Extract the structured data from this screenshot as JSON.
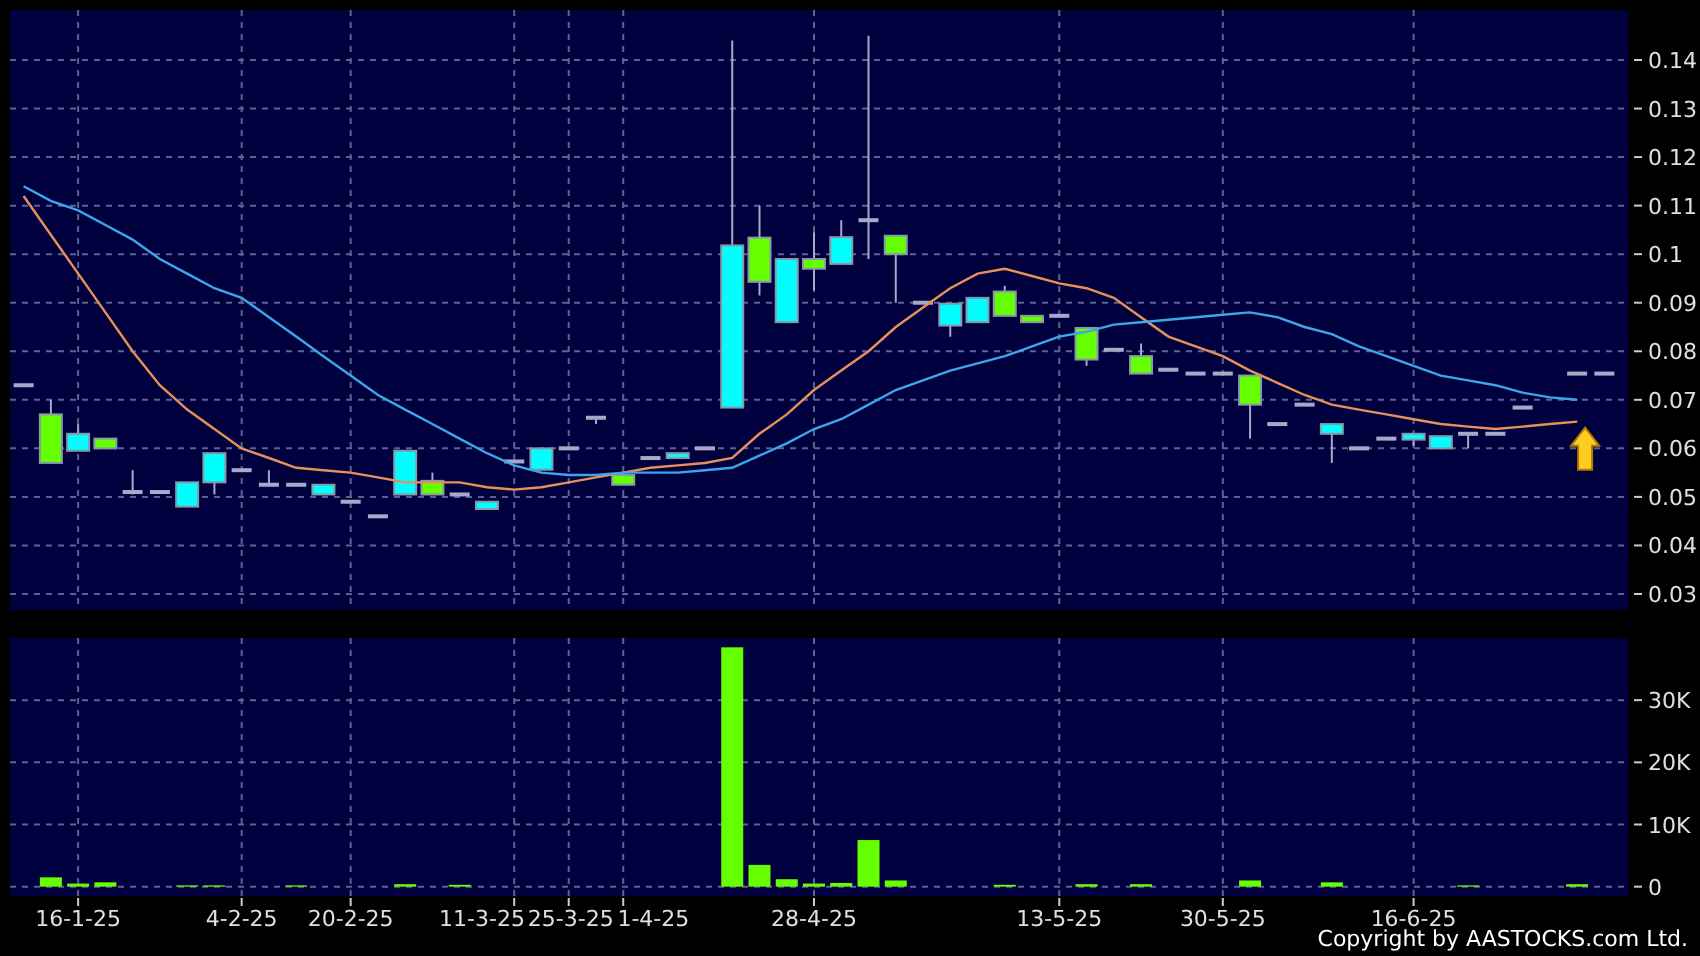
{
  "price_chart": {
    "chart_data": {
      "type": "candlestick",
      "grid": true,
      "ylim": [
        0.0267,
        0.1503
      ],
      "categories": [
        null,
        null,
        null,
        null,
        null,
        null,
        null,
        null,
        null,
        null,
        null,
        null,
        null,
        null,
        null,
        null,
        null,
        null,
        null,
        null,
        null,
        null,
        null,
        null,
        null,
        null,
        null,
        null,
        null,
        null,
        null,
        null,
        null,
        null,
        null,
        null,
        null,
        null,
        null,
        null,
        null,
        null,
        null,
        null,
        null,
        null,
        null,
        null,
        null,
        null,
        null,
        null,
        null,
        null,
        null,
        null,
        null,
        null,
        null
      ],
      "yticks": [
        {
          "value": 0.03,
          "label": "0.03"
        },
        {
          "value": 0.04,
          "label": "0.04"
        },
        {
          "value": 0.05,
          "label": "0.05"
        },
        {
          "value": 0.06,
          "label": "0.06"
        },
        {
          "value": 0.07,
          "label": "0.07"
        },
        {
          "value": 0.08,
          "label": "0.08"
        },
        {
          "value": 0.09,
          "label": "0.09"
        },
        {
          "value": 0.1,
          "label": "0.1"
        },
        {
          "value": 0.11,
          "label": "0.11"
        },
        {
          "value": 0.12,
          "label": "0.12"
        },
        {
          "value": 0.13,
          "label": "0.13"
        },
        {
          "value": 0.14,
          "label": "0.14"
        }
      ],
      "ohlc": [
        [
          0.073,
          0.073,
          0.073,
          0.073
        ],
        [
          0.067,
          0.07,
          0.057,
          0.057
        ],
        [
          0.0595,
          0.065,
          0.0595,
          0.063
        ],
        [
          0.062,
          0.062,
          0.06,
          0.06
        ],
        [
          0.051,
          0.0555,
          0.0505,
          0.051
        ],
        [
          0.051,
          0.051,
          0.051,
          0.051
        ],
        [
          0.048,
          0.053,
          0.048,
          0.053
        ],
        [
          0.053,
          0.059,
          0.0505,
          0.059
        ],
        [
          0.0555,
          0.0555,
          0.0555,
          0.0555
        ],
        [
          0.0525,
          0.0555,
          0.0525,
          0.0525
        ],
        [
          0.0525,
          0.0525,
          0.0525,
          0.0525
        ],
        [
          0.0505,
          0.0525,
          0.0505,
          0.0525
        ],
        [
          0.049,
          0.049,
          0.049,
          0.049
        ],
        [
          0.046,
          0.046,
          0.046,
          0.046
        ],
        [
          0.0505,
          0.0595,
          0.0505,
          0.0595
        ],
        [
          0.0533,
          0.055,
          0.0505,
          0.0505
        ],
        [
          0.0505,
          0.0505,
          0.0505,
          0.0505
        ],
        [
          0.0475,
          0.049,
          0.0475,
          0.049
        ],
        [
          0.0573,
          0.0573,
          0.0573,
          0.0573
        ],
        [
          0.0556,
          0.06,
          0.0556,
          0.06
        ],
        [
          0.06,
          0.06,
          0.06,
          0.06
        ],
        [
          0.0663,
          0.0663,
          0.065,
          0.0663
        ],
        [
          0.0545,
          0.0545,
          0.0525,
          0.0525
        ],
        [
          0.058,
          0.058,
          0.058,
          0.058
        ],
        [
          0.058,
          0.059,
          0.058,
          0.059
        ],
        [
          0.06,
          0.06,
          0.06,
          0.06
        ],
        [
          0.0684,
          0.144,
          0.0684,
          0.1018
        ],
        [
          0.1034,
          0.11,
          0.0915,
          0.0943
        ],
        [
          0.086,
          0.099,
          0.086,
          0.099
        ],
        [
          0.099,
          0.1045,
          0.0925,
          0.097
        ],
        [
          0.098,
          0.107,
          0.098,
          0.1035
        ],
        [
          0.107,
          0.145,
          0.099,
          0.107
        ],
        [
          0.1038,
          0.1038,
          0.09,
          0.1
        ],
        [
          0.09,
          0.09,
          0.09,
          0.09
        ],
        [
          0.0853,
          0.0898,
          0.083,
          0.0898
        ],
        [
          0.086,
          0.091,
          0.086,
          0.091
        ],
        [
          0.0923,
          0.0935,
          0.0873,
          0.0873
        ],
        [
          0.0873,
          0.0873,
          0.086,
          0.086
        ],
        [
          0.0873,
          0.0873,
          0.0873,
          0.0873
        ],
        [
          0.0848,
          0.0848,
          0.077,
          0.0783
        ],
        [
          0.0803,
          0.0803,
          0.0803,
          0.0803
        ],
        [
          0.079,
          0.0816,
          0.0754,
          0.0754
        ],
        [
          0.0762,
          0.0762,
          0.0762,
          0.0762
        ],
        [
          0.0754,
          0.0754,
          0.0754,
          0.0754
        ],
        [
          0.0754,
          0.0754,
          0.0754,
          0.0754
        ],
        [
          0.075,
          0.075,
          0.062,
          0.069
        ],
        [
          0.065,
          0.065,
          0.065,
          0.065
        ],
        [
          0.069,
          0.069,
          0.069,
          0.069
        ],
        [
          0.063,
          0.065,
          0.057,
          0.065
        ],
        [
          0.06,
          0.06,
          0.06,
          0.06
        ],
        [
          0.062,
          0.062,
          0.062,
          0.062
        ],
        [
          0.0618,
          0.063,
          0.0605,
          0.063
        ],
        [
          0.06,
          0.0625,
          0.06,
          0.0625
        ],
        [
          0.063,
          0.063,
          0.06,
          0.063
        ],
        [
          0.063,
          0.063,
          0.063,
          0.063
        ],
        [
          0.0684,
          0.0684,
          0.0684,
          0.0684
        ],
        null,
        [
          0.0754,
          0.0754,
          0.0754,
          0.0754
        ],
        [
          0.0754,
          0.0754,
          0.0754,
          0.0754
        ]
      ],
      "series": [
        {
          "type": "line",
          "color": "#e8905a",
          "values": [
            0.112,
            0.104,
            0.096,
            0.088,
            0.08,
            0.073,
            0.068,
            0.064,
            0.06,
            0.058,
            0.056,
            0.0555,
            0.055,
            0.054,
            0.053,
            0.053,
            0.053,
            0.052,
            0.0515,
            0.052,
            0.053,
            0.054,
            0.055,
            0.056,
            0.0565,
            0.057,
            0.058,
            0.063,
            0.067,
            0.072,
            0.076,
            0.08,
            0.085,
            0.089,
            0.093,
            0.096,
            0.097,
            0.0955,
            0.094,
            0.093,
            0.091,
            0.087,
            0.083,
            0.081,
            0.079,
            0.076,
            0.0735,
            0.071,
            0.069,
            0.068,
            0.067,
            0.066,
            0.065,
            0.0645,
            0.064,
            0.0645,
            0.065,
            0.0655,
            null
          ]
        },
        {
          "type": "line",
          "color": "#3aa8e8",
          "values": [
            0.114,
            0.111,
            0.109,
            0.106,
            0.103,
            0.099,
            0.096,
            0.093,
            0.091,
            0.087,
            0.083,
            0.079,
            0.075,
            0.071,
            0.068,
            0.065,
            0.062,
            0.059,
            0.0565,
            0.055,
            0.0545,
            0.0545,
            0.055,
            0.055,
            0.055,
            0.0555,
            0.056,
            0.0585,
            0.061,
            0.064,
            0.066,
            0.069,
            0.072,
            0.074,
            0.076,
            0.0775,
            0.079,
            0.081,
            0.083,
            0.084,
            0.0855,
            0.086,
            0.0865,
            0.087,
            0.0875,
            0.088,
            0.087,
            0.085,
            0.0835,
            0.081,
            0.079,
            0.077,
            0.075,
            0.074,
            0.073,
            0.0715,
            0.0705,
            0.07,
            null
          ]
        }
      ]
    }
  },
  "volume_chart": {
    "chart_data": {
      "type": "bar",
      "grid": true,
      "ylim": [
        -1.5,
        40
      ],
      "categories": [
        null,
        null,
        "16-1-25",
        null,
        null,
        null,
        null,
        null,
        "4-2-25",
        null,
        null,
        null,
        "20-2-25",
        null,
        null,
        null,
        null,
        null,
        "11-3-25",
        null,
        "25-3-25",
        null,
        "1-4-25",
        null,
        null,
        null,
        null,
        null,
        null,
        "28-4-25",
        null,
        null,
        null,
        null,
        null,
        null,
        null,
        null,
        "13-5-25",
        null,
        null,
        null,
        null,
        null,
        "30-5-25",
        null,
        null,
        null,
        null,
        null,
        null,
        "16-6-25",
        null,
        null,
        null,
        null,
        null,
        null,
        null
      ],
      "yticks": [
        {
          "value": 0,
          "label": "0"
        },
        {
          "value": 10,
          "label": "10K"
        },
        {
          "value": 20,
          "label": "20K"
        },
        {
          "value": 30,
          "label": "30K"
        }
      ],
      "series": [
        {
          "color": "#66ff00",
          "values": [
            0,
            1.5,
            0.5,
            0.7,
            0,
            0,
            0.2,
            0.2,
            0,
            0,
            0.2,
            0,
            0,
            0,
            0.4,
            0,
            0.3,
            0,
            0,
            0,
            0,
            0,
            0,
            0,
            0,
            0,
            38.5,
            3.5,
            1.2,
            0.5,
            0.6,
            7.5,
            1,
            0,
            0,
            0,
            0.3,
            0,
            0,
            0.4,
            0,
            0.4,
            0,
            0,
            0,
            1,
            0,
            0,
            0.7,
            0,
            0,
            0,
            0,
            0.2,
            0,
            0,
            0,
            0.4,
            0
          ]
        }
      ]
    }
  },
  "copyright": "Copyright by AASTOCKS.com Ltd."
}
